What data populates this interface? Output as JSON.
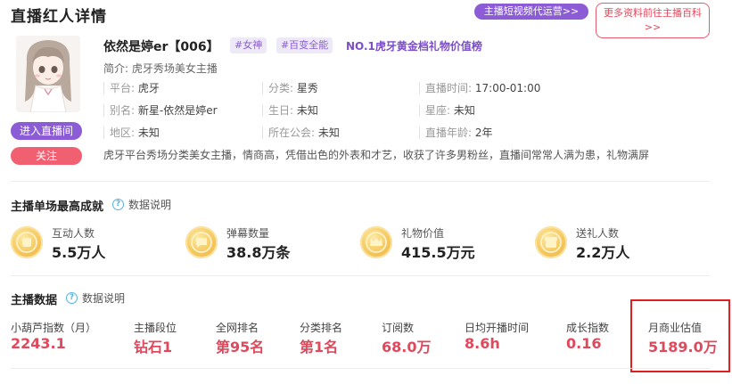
{
  "header": {
    "title": "直播红人详情",
    "video_agency_button": "主播短视频代运营>>",
    "more_info_button_line1": "更多资料前往主播百科",
    "more_info_button_line2": ">>"
  },
  "profile": {
    "name": "依然是婷er【006】",
    "tags": [
      "#女神",
      "#百变全能"
    ],
    "rank": "NO.1虎牙黄金档礼物价值榜",
    "intro": "简介: 虎牙秀场美女主播",
    "enter_button": "进入直播间",
    "follow_button": "关注",
    "info": {
      "platform_label": "平台:",
      "platform": "虎牙",
      "category_label": "分类:",
      "category": "星秀",
      "live_time_label": "直播时间:",
      "live_time": "17:00-01:00",
      "alias_label": "别名:",
      "alias": "新星-依然是婷er",
      "birthday_label": "生日:",
      "birthday": "未知",
      "constellation_label": "星座:",
      "constellation": "未知",
      "region_label": "地区:",
      "region": "未知",
      "guild_label": "所在公会:",
      "guild": "未知",
      "years_label": "直播年龄:",
      "years": "2年"
    },
    "description": "虎牙平台秀场分类美女主播，情商高，凭借出色的外表和才艺，收获了许多男粉丝，直播间常常人满为患，礼物满屏"
  },
  "achievements": {
    "title": "主播单场最高成就",
    "help": "数据说明",
    "items": [
      {
        "label": "互动人数",
        "value": "5.5万人"
      },
      {
        "label": "弹幕数量",
        "value": "38.8万条"
      },
      {
        "label": "礼物价值",
        "value": "415.5万元"
      },
      {
        "label": "送礼人数",
        "value": "2.2万人"
      }
    ]
  },
  "metrics": {
    "title": "主播数据",
    "help": "数据说明",
    "items": [
      {
        "label": "小葫芦指数（月）",
        "value": "2243.1"
      },
      {
        "label": "主播段位",
        "value": "钻石1"
      },
      {
        "label": "全网排名",
        "value": "第95名"
      },
      {
        "label": "分类排名",
        "value": "第1名"
      },
      {
        "label": "订阅数",
        "value": "68.0万"
      },
      {
        "label": "日均开播时间",
        "value": "8.6h"
      },
      {
        "label": "成长指数",
        "value": "0.16"
      },
      {
        "label": "月商业估值",
        "value": "5189.0万"
      }
    ]
  },
  "colors": {
    "accent_purple": "#8b5cd6",
    "accent_red": "#e0485c",
    "highlight_border": "#e02020",
    "medal_gold": "#f5c75c"
  }
}
